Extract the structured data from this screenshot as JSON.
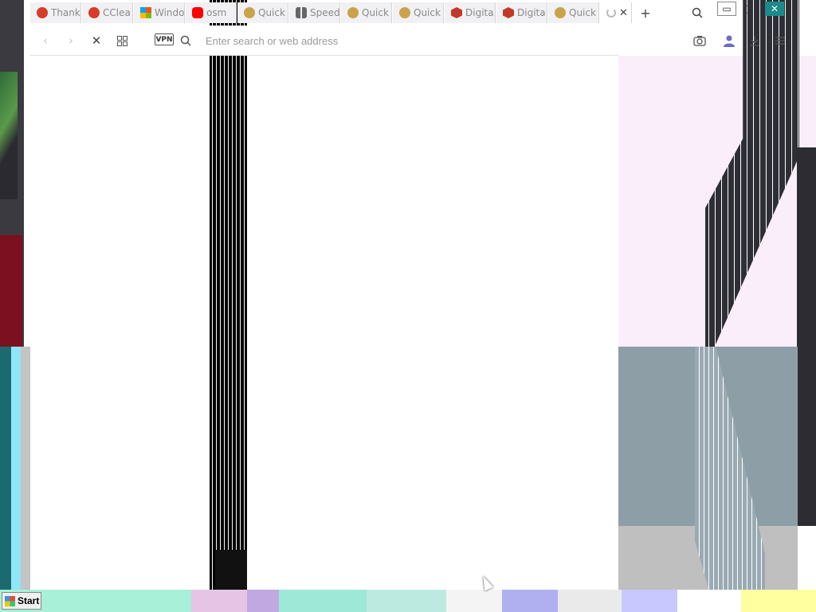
{
  "tabs": [
    {
      "label": "Thank",
      "icon": "ccleaner-icon",
      "color": "#d83b2a"
    },
    {
      "label": "CClea",
      "icon": "ccleaner-icon",
      "color": "#d83b2a"
    },
    {
      "label": "Windo",
      "icon": "windows-logo-icon",
      "color": "#1e88e5"
    },
    {
      "label": "osm",
      "icon": "youtube-icon",
      "color": "#ff0000"
    },
    {
      "label": "Quick",
      "icon": "quickheal-icon",
      "color": "#8a6a20"
    },
    {
      "label": "Speed",
      "icon": "speed-dial-icon",
      "color": "#666666"
    },
    {
      "label": "Quick",
      "icon": "quickheal-icon",
      "color": "#8a6a20"
    },
    {
      "label": "Quick",
      "icon": "quickheal-icon",
      "color": "#8a6a20"
    },
    {
      "label": "Digita",
      "icon": "shield-icon",
      "color": "#c0392b"
    },
    {
      "label": "Digita",
      "icon": "shield-icon",
      "color": "#c0392b"
    },
    {
      "label": "Quick",
      "icon": "quickheal-icon",
      "color": "#8a6a20"
    }
  ],
  "toolbar": {
    "vpn_label": "VPN",
    "address_placeholder": "Enter search or web address"
  },
  "taskbar": {
    "start_label": "Start"
  }
}
